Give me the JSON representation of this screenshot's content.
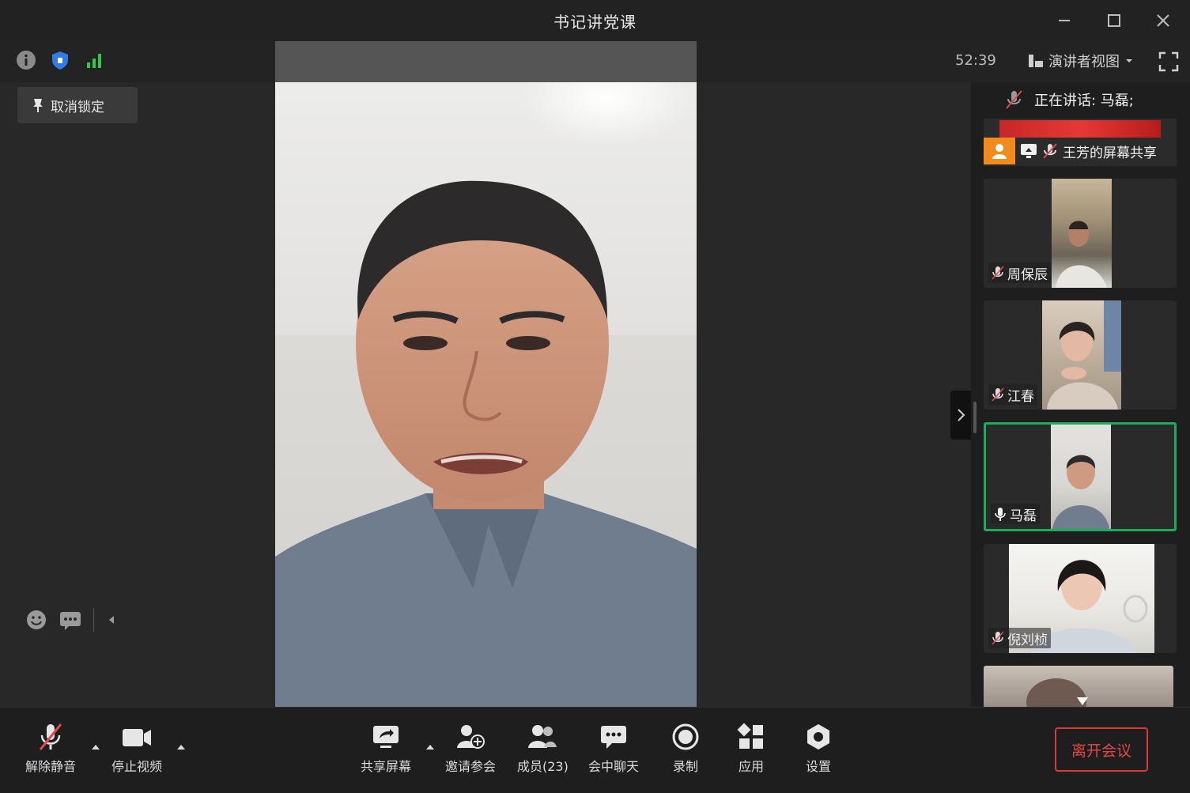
{
  "window": {
    "title": "书记讲党课"
  },
  "topbar": {
    "timer": "52:39",
    "view_label": "演讲者视图"
  },
  "stage": {
    "unpin_label": "取消锁定"
  },
  "side": {
    "speaking_label": "正在讲话: 马磊;",
    "share_label": "王芳的屏幕共享",
    "participants": [
      {
        "name": "周保辰"
      },
      {
        "name": "江春"
      },
      {
        "name": "马磊"
      },
      {
        "name": "倪刘桢"
      }
    ]
  },
  "toolbar": {
    "unmute": "解除静音",
    "stop_video": "停止视频",
    "share_screen": "共享屏幕",
    "invite": "邀请参会",
    "members": "成员(23)",
    "chat": "会中聊天",
    "record": "录制",
    "apps": "应用",
    "settings": "设置",
    "leave": "离开会议"
  },
  "colors": {
    "active_speaker": "#1faa5c",
    "leave": "#e24848",
    "signal": "#2ec94b",
    "shield": "#2f7be8",
    "share_badge": "#f08c1e"
  }
}
